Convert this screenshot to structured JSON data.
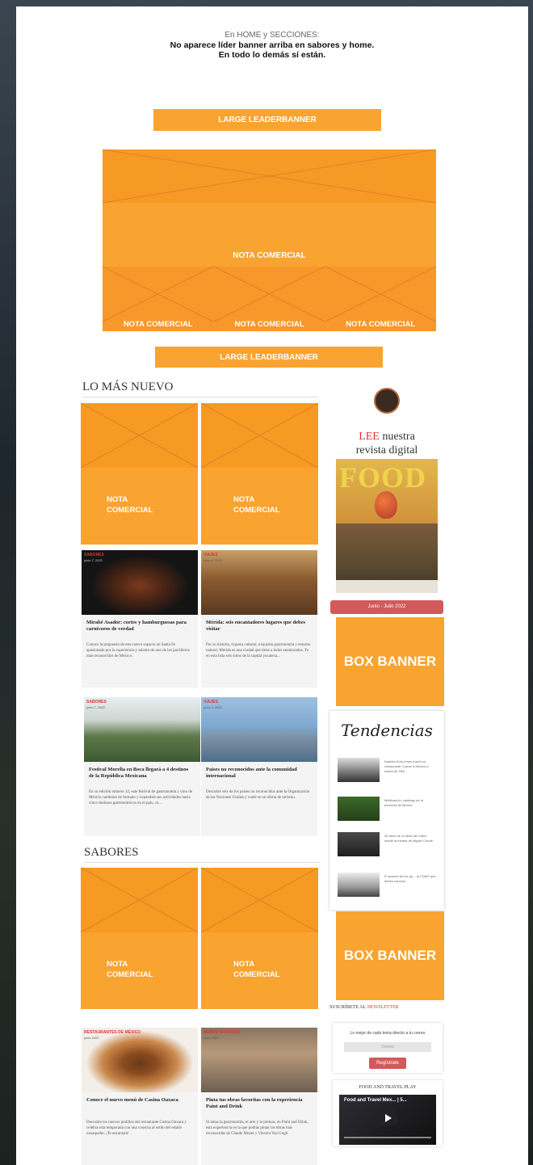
{
  "note": {
    "line1": "En HOME y SECCIONES:",
    "line2": "No aparece líder banner arriba en sabores y home.",
    "line3": "En todo lo demás sí están."
  },
  "banners": {
    "large_leaderbanner_top": "LARGE LEADERBANNER",
    "large_leaderbanner_mid": "LARGE LEADERBANNER"
  },
  "hero": {
    "main_label": "NOTA COMERCIAL",
    "small_labels": [
      "NOTA COMERCIAL",
      "NOTA COMERCIAL",
      "NOTA COMERCIAL"
    ]
  },
  "lo_mas_nuevo": {
    "heading": "LO MÁS NUEVO",
    "ad_cards": [
      {
        "label": "NOTA\nCOMERCIAL"
      },
      {
        "label": "NOTA\nCOMERCIAL"
      }
    ],
    "posts": [
      {
        "category": "SABORES",
        "date": "junio 7, 2022",
        "title": "Mirabé Asador: cortes y hamburguesas para carnívoros de verdad",
        "excerpt": "Conoce la propuesta de este nuevo espacio en Santa Fe apasionado por la experiencia y talento de uno de los parrilleros más reconocidos de México."
      },
      {
        "category": "VIAJES",
        "date": "junio 6, 2022",
        "title": "Mérida: seis encantadores lugares que debes visitar",
        "excerpt": "Por su historia, riqueza cultural, exquisita gastronomía y entorno natural, Mérida es una ciudad que tiene a todos enamorados. Te en esta lista seis sitios de la capital yucateca..."
      },
      {
        "category": "SABORES",
        "date": "junio 7, 2022",
        "title": "Festival Morelia en Boca llegará a 4 destinos de la República Mexicana",
        "excerpt": "En su edición número 12, este festival de gastronomía y vino de México cambiará de formato y expandirá sus actividades hacia cinco destinos gastronómicos en el país, co..."
      },
      {
        "category": "VIAJES",
        "date": "junio 3, 2022",
        "title": "Países no reconocidos ante la comunidad internacional",
        "excerpt": "Descubre seis de los países no reconocidos ante la Organización de las Naciones Unidas y vuelé en su oferta de turismo."
      }
    ]
  },
  "sabores": {
    "heading": "SABORES",
    "ad_cards": [
      {
        "label": "NOTA\nCOMERCIAL"
      },
      {
        "label": "NOTA\nCOMERCIAL"
      }
    ],
    "posts": [
      {
        "category": "RESTAURANTES DE MÉXICO",
        "date": "junio 2022",
        "title": "Conoce el nuevo menú de Casina Oaxaca",
        "excerpt": "Descubre los nuevos platillos del restaurante Casina Oaxaca y celebra esta temporada con una cosecha al estilo del estado oaxaqueño. ¡Te encantará!"
      },
      {
        "category": "MENÚS OUTDOOR",
        "date": "junio 2022",
        "title": "Pinta tus obras favoritas con la experiencia Paint and Drink",
        "excerpt": "Si amas la gastronomía, el arte y la pintura, en Paint and Drink, esta experiencia en la que podrás pintar las obras más reconocidas de Claude Monet y Vincent Van Gogh."
      }
    ]
  },
  "sidebar": {
    "lee": "LEE",
    "lee_rest": " nuestra",
    "lee_line2": "revista digital",
    "magazine_title": "FOOD",
    "issue_button": "Junio - Julio 2022",
    "box_banner_1": "BOX BANNER",
    "box_banner_2": "BOX BANNER",
    "tendencias_title": "Tendencias",
    "tendencias": [
      {
        "text": "Daniela Soto-Innes traerá su restaurante Cosme a México a través de TBD"
      },
      {
        "text": "Mixlficación: catálogo de la herencia de México"
      },
      {
        "text": "30 años de La Bola del Sabor desde la mirada de Miguel Conde"
      },
      {
        "text": "5 razones de los (a)... la CDMX que debes conocer"
      }
    ],
    "newsletter_a": "SUSCRÍBETE AL ",
    "newsletter_b": "NEWSLETTER",
    "newsletter_text": "Lo mejor de cada tema directo a tu correo",
    "email_placeholder": "Correo",
    "register_button": "Regístrate",
    "play_title": "FOOD AND TRAVEL PLAY",
    "video_title": "Food and Travel Mex... | 5..."
  },
  "colors": {
    "orange": "#f9a330",
    "orange_dark": "#f69a24",
    "accent_red": "#d25a5a"
  }
}
